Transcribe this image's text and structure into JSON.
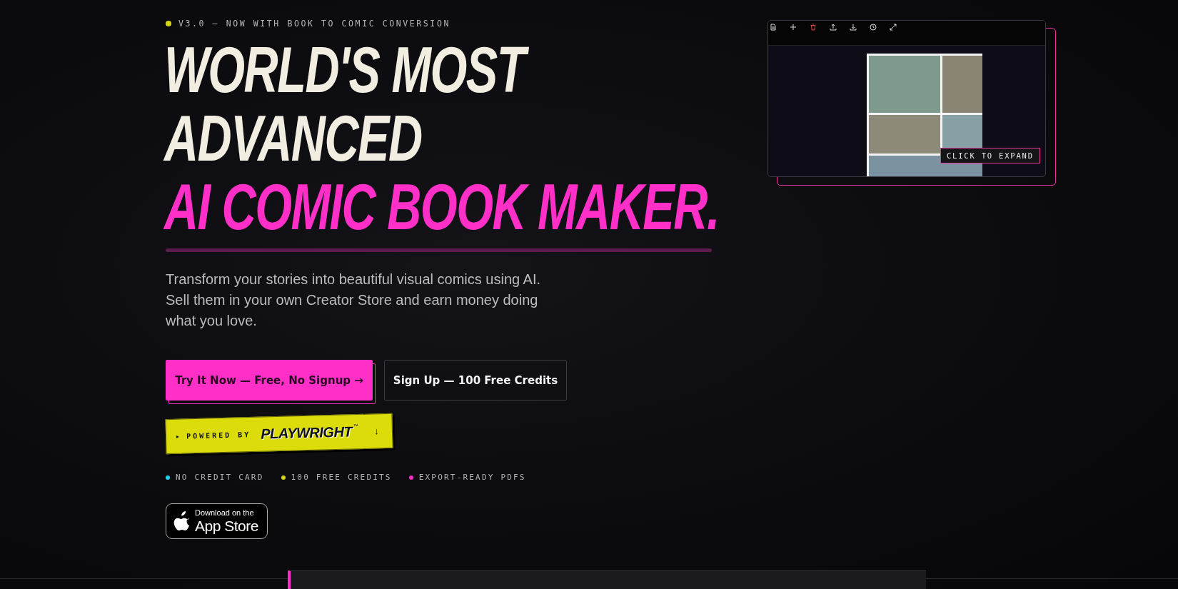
{
  "announcement": {
    "text": "V3.0 — NOW WITH BOOK TO COMIC CONVERSION",
    "color": "#d6d61a"
  },
  "heading": {
    "lines": [
      "WORLD'S MOST",
      "ADVANCED"
    ],
    "highlight": "AI COMIC BOOK MAKER."
  },
  "subtitle": "Transform your stories into beautiful visual comics using AI. Sell them in your own Creator Store and earn money doing what you love.",
  "buttons": [
    {
      "label": "Try It Now — Free, No Signup →",
      "kind": "primary"
    },
    {
      "label": "Sign Up — 100 Free Credits",
      "kind": "secondary"
    }
  ],
  "powered_badge": {
    "marker": "▸",
    "label": "POWERED BY",
    "brand": "PLAYWRIGHT",
    "mark": "™",
    "arrow": "↓"
  },
  "features": [
    {
      "label": "NO CREDIT CARD",
      "color": "#22d3e6"
    },
    {
      "label": "100 FREE CREDITS",
      "color": "#d6d61a"
    },
    {
      "label": "EXPORT-READY PDFS",
      "color": "#f02fc2"
    }
  ],
  "app_store": {
    "small": "Download on the",
    "large": "App Store"
  },
  "preview": {
    "toolbar": [
      {
        "kind": "file"
      },
      {
        "kind": "plus"
      },
      {
        "kind": "trash"
      },
      {
        "kind": "upload"
      },
      {
        "kind": "download"
      },
      {
        "kind": "clock"
      },
      {
        "kind": "expand"
      }
    ],
    "expand_label": "CLICK TO EXPAND"
  }
}
